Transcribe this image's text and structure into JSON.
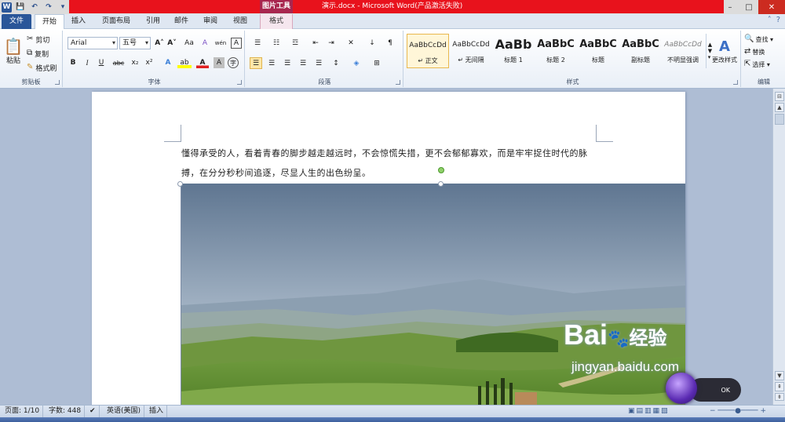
{
  "window": {
    "title": "演示.docx - Microsoft Word(产品激活失败)",
    "context_tab_group": "图片工具",
    "minimize": "–",
    "maximize": "□",
    "close": "✕"
  },
  "qat": {
    "save": "💾",
    "undo": "↶",
    "redo": "↷",
    "more": "▾"
  },
  "tabs": [
    {
      "label": "文件"
    },
    {
      "label": "开始"
    },
    {
      "label": "插入"
    },
    {
      "label": "页面布局"
    },
    {
      "label": "引用"
    },
    {
      "label": "邮件"
    },
    {
      "label": "审阅"
    },
    {
      "label": "视图"
    },
    {
      "label": "格式"
    }
  ],
  "ribbon": {
    "clipboard": {
      "group_label": "剪贴板",
      "paste": "粘贴",
      "cut": "剪切",
      "copy": "复制",
      "format_painter": "格式刷"
    },
    "font": {
      "group_label": "字体",
      "font_name": "Arial",
      "font_size": "五号",
      "grow": "A˄",
      "shrink": "A˅",
      "change_case": "Aa",
      "clear": "A",
      "phonetic": "wén",
      "char_border": "A",
      "bold": "B",
      "italic": "I",
      "underline": "U",
      "strike": "abc",
      "subscript": "x₂",
      "superscript": "x²",
      "text_effect": "A",
      "highlight": "ab",
      "font_color": "A",
      "char_shade": "A",
      "enclose": "字"
    },
    "paragraph": {
      "group_label": "段落",
      "bullets": "☰",
      "numbering": "☷",
      "multilevel": "☲",
      "decrease_indent": "⇤",
      "increase_indent": "⇥",
      "chinese_layout": "✕",
      "sort": "↓",
      "show_marks": "¶",
      "align_left": "☰",
      "center": "☰",
      "align_right": "☰",
      "justify": "☰",
      "distributed": "☰",
      "line_spacing": "↕",
      "shading": "◈",
      "borders": "⊞"
    },
    "styles": {
      "group_label": "样式",
      "items": [
        {
          "sample": "AaBbCcDd",
          "name": "↵ 正文"
        },
        {
          "sample": "AaBbCcDd",
          "name": "↵ 无间隔"
        },
        {
          "sample": "AaBb",
          "name": "标题 1"
        },
        {
          "sample": "AaBbC",
          "name": "标题 2"
        },
        {
          "sample": "AaBbC",
          "name": "标题"
        },
        {
          "sample": "AaBbC",
          "name": "副标题"
        },
        {
          "sample": "AaBbCcDd",
          "name": "不明显强调"
        }
      ],
      "change_styles": "更改样式"
    },
    "editing": {
      "group_label": "编辑",
      "find": "查找 ▾",
      "replace": "替换",
      "select": "选择 ▾"
    }
  },
  "document": {
    "paragraph": "懂得承受的人，看着青春的脚步越走越远时，不会惊慌失措，更不会郁郁寡欢，而是牢牢捉住时代的脉搏，在分分秒秒间追逐，尽显人生的出色纷呈。"
  },
  "watermark": {
    "brand": "Bai",
    "brand_cn": "经验",
    "url": "jingyan.baidu.com"
  },
  "status": {
    "page": "页面: 1/10",
    "words": "字数: 448",
    "language": "英语(美国)",
    "mode": "插入"
  },
  "colors": {
    "title_red": "#e8121c",
    "file_tab": "#2a5699",
    "picture_tools": "#a8264f",
    "selected_style": "#e9b84e"
  }
}
